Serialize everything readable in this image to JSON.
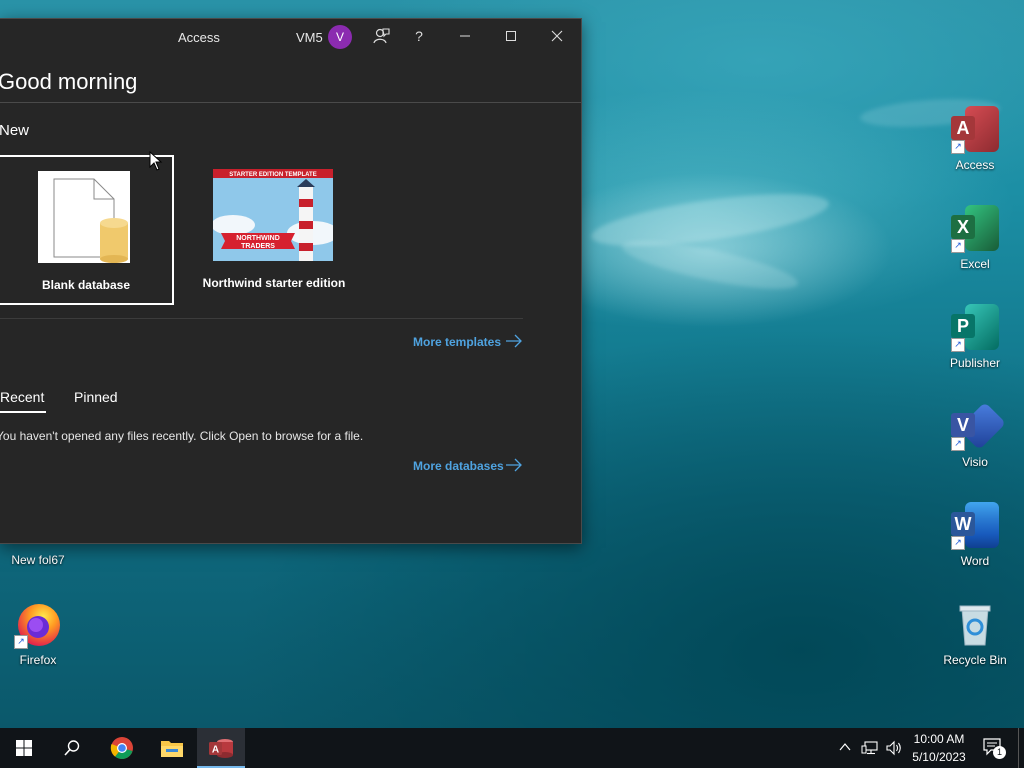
{
  "window": {
    "app_title": "Access",
    "user_name": "VM5",
    "avatar_initial": "V",
    "greeting": "Good morning",
    "new_section_label": "New",
    "templates": [
      {
        "label": "Blank database",
        "selected": true
      },
      {
        "label": "Northwind starter edition",
        "selected": false
      }
    ],
    "northwind_thumb": {
      "banner_text": "STARTER EDITION TEMPLATE",
      "ribbon_line1": "NORTHWIND",
      "ribbon_line2": "TRADERS"
    },
    "more_templates_label": "More templates",
    "tabs": [
      {
        "label": "Recent",
        "active": true
      },
      {
        "label": "Pinned",
        "active": false
      }
    ],
    "empty_recent_message": "You haven't opened any files recently. Click Open to browse for a file.",
    "more_databases_label": "More databases"
  },
  "desktop": {
    "icons": [
      {
        "name": "Access",
        "icon": "access-icon",
        "color": "#a4373a"
      },
      {
        "name": "Excel",
        "icon": "excel-icon",
        "color": "#1d6f42"
      },
      {
        "name": "Publisher",
        "icon": "publisher-icon",
        "color": "#077568"
      },
      {
        "name": "Visio",
        "icon": "visio-icon",
        "color": "#3955a3"
      },
      {
        "name": "Word",
        "icon": "word-icon",
        "color": "#2b579a"
      },
      {
        "name": "Recycle Bin",
        "icon": "recycle-bin-icon"
      },
      {
        "name": "New fol67",
        "icon": "folder-icon"
      },
      {
        "name": "Firefox",
        "icon": "firefox-icon"
      }
    ]
  },
  "taskbar": {
    "items": [
      "start-icon",
      "search-icon",
      "chrome-icon",
      "file-explorer-icon",
      "access-icon"
    ],
    "active_item": "access-icon",
    "clock_time": "10:00 AM",
    "clock_date": "5/10/2023",
    "notification_count": "1"
  },
  "colors": {
    "window_bg": "#262626",
    "link": "#4fa3e0",
    "avatar": "#8b2bb0",
    "taskbar_bg": "#101418"
  }
}
